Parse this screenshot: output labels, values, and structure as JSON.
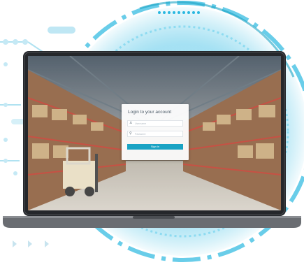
{
  "login": {
    "title": "Login to your account",
    "username_placeholder": "Username",
    "password_placeholder": "Password",
    "signin_label": "Sign in"
  },
  "icons": {
    "user": "user-icon",
    "key": "key-icon"
  },
  "colors": {
    "accent": "#1aa3c4",
    "deco_cyan": "#29b8e0",
    "laptop_frame": "#2a2c30"
  }
}
